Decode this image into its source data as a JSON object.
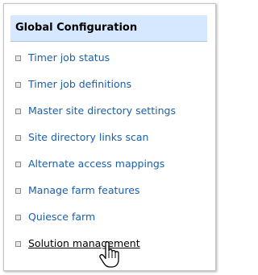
{
  "panel": {
    "title": "Global Configuration",
    "items": [
      {
        "label": "Timer job status"
      },
      {
        "label": "Timer job definitions"
      },
      {
        "label": "Master site directory settings"
      },
      {
        "label": "Site directory links scan"
      },
      {
        "label": "Alternate access mappings"
      },
      {
        "label": "Manage farm features"
      },
      {
        "label": "Quiesce farm"
      },
      {
        "label": "Solution management"
      }
    ],
    "hovered_item": "Solution management"
  },
  "colors": {
    "header_background": "#d6e8ff",
    "link": "#1b5fa8",
    "hover_link": "#000000"
  },
  "icons": {
    "bullet": "square-bullet-icon",
    "cursor": "hand-pointer-cursor-icon"
  }
}
